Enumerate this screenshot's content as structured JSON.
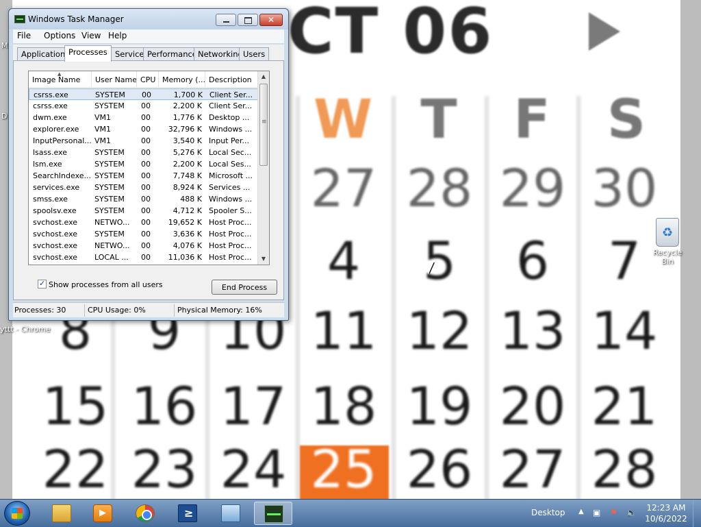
{
  "desktop": {
    "wallpaper": {
      "month_text": "CT 06",
      "weekdays": [
        "W",
        "T",
        "F",
        "S"
      ],
      "weekday_colors": [
        "#f09a55",
        "#777777",
        "#777777",
        "#777777"
      ],
      "weeks": [
        [
          "27",
          "28",
          "29",
          "30"
        ],
        [
          "4",
          "5",
          "6",
          "7"
        ],
        [
          "8",
          "9",
          "10",
          "11",
          "12",
          "13",
          "14"
        ],
        [
          "15",
          "16",
          "17",
          "18",
          "19",
          "20",
          "21"
        ],
        [
          "22",
          "23",
          "24",
          "25",
          "26",
          "27",
          "28"
        ]
      ],
      "today": "25",
      "today_color": "#f07022"
    },
    "icons": {
      "recycle_bin": "Recycle Bin",
      "chrome_shortcut": "yttt - Chrome"
    },
    "side_letters": [
      "M",
      "D"
    ]
  },
  "task_manager": {
    "title": "Windows Task Manager",
    "menu": [
      "File",
      "Options",
      "View",
      "Help"
    ],
    "tabs": [
      "Applications",
      "Processes",
      "Services",
      "Performance",
      "Networking",
      "Users"
    ],
    "active_tab": "Processes",
    "columns": [
      "Image Name",
      "User Name",
      "CPU",
      "Memory (...",
      "Description"
    ],
    "processes": [
      {
        "image": "csrss.exe",
        "user": "SYSTEM",
        "cpu": "00",
        "memory": "1,700 K",
        "desc": "Client Ser..."
      },
      {
        "image": "csrss.exe",
        "user": "SYSTEM",
        "cpu": "00",
        "memory": "2,200 K",
        "desc": "Client Ser..."
      },
      {
        "image": "dwm.exe",
        "user": "VM1",
        "cpu": "00",
        "memory": "1,776 K",
        "desc": "Desktop ..."
      },
      {
        "image": "explorer.exe",
        "user": "VM1",
        "cpu": "00",
        "memory": "32,796 K",
        "desc": "Windows ..."
      },
      {
        "image": "InputPersonal...",
        "user": "VM1",
        "cpu": "00",
        "memory": "3,540 K",
        "desc": "Input Per..."
      },
      {
        "image": "lsass.exe",
        "user": "SYSTEM",
        "cpu": "00",
        "memory": "5,276 K",
        "desc": "Local Sec..."
      },
      {
        "image": "lsm.exe",
        "user": "SYSTEM",
        "cpu": "00",
        "memory": "2,200 K",
        "desc": "Local Ses..."
      },
      {
        "image": "SearchIndexe...",
        "user": "SYSTEM",
        "cpu": "00",
        "memory": "7,748 K",
        "desc": "Microsoft ..."
      },
      {
        "image": "services.exe",
        "user": "SYSTEM",
        "cpu": "00",
        "memory": "8,924 K",
        "desc": "Services ..."
      },
      {
        "image": "smss.exe",
        "user": "SYSTEM",
        "cpu": "00",
        "memory": "488 K",
        "desc": "Windows ..."
      },
      {
        "image": "spoolsv.exe",
        "user": "SYSTEM",
        "cpu": "00",
        "memory": "4,712 K",
        "desc": "Spooler S..."
      },
      {
        "image": "svchost.exe",
        "user": "NETWO...",
        "cpu": "00",
        "memory": "19,652 K",
        "desc": "Host Proc..."
      },
      {
        "image": "svchost.exe",
        "user": "SYSTEM",
        "cpu": "00",
        "memory": "3,636 K",
        "desc": "Host Proc..."
      },
      {
        "image": "svchost.exe",
        "user": "NETWO...",
        "cpu": "00",
        "memory": "4,076 K",
        "desc": "Host Proc..."
      },
      {
        "image": "svchost.exe",
        "user": "LOCAL ...",
        "cpu": "00",
        "memory": "11,036 K",
        "desc": "Host Proc..."
      }
    ],
    "selected_row": 0,
    "show_all_label": "Show processes from all users",
    "show_all_checked": true,
    "end_process_label": "End Process",
    "status": {
      "processes": "Processes: 30",
      "cpu_usage": "CPU Usage: 0%",
      "physical_memory": "Physical Memory: 16%"
    }
  },
  "taskbar": {
    "pinned": [
      "windows-explorer-icon",
      "media-player-icon",
      "chrome-icon",
      "powershell-icon",
      "remote-desktop-icon",
      "task-manager-icon"
    ],
    "active": "task-manager-icon",
    "desktop_label": "Desktop",
    "clock_time": "12:23 AM",
    "clock_date": "10/6/2022"
  }
}
